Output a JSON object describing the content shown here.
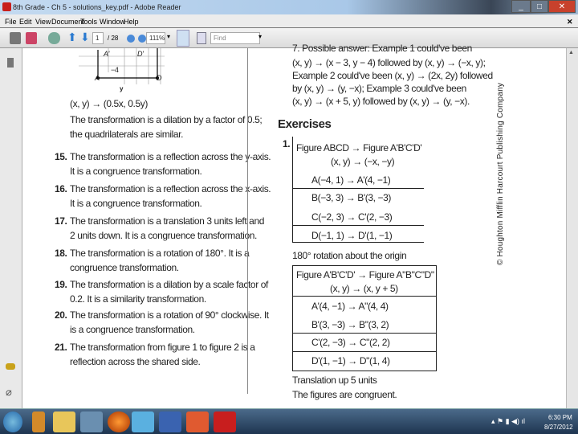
{
  "window": {
    "title": "8th Grade - Ch 5 - solutions_key.pdf - Adobe Reader",
    "controls": [
      "minimize",
      "maximize",
      "close"
    ]
  },
  "menu": [
    "File",
    "Edit",
    "View",
    "Document",
    "Tools",
    "Window",
    "Help"
  ],
  "toolbar": {
    "page_current": "1",
    "page_total": "/ 28",
    "zoom": "111%",
    "find_placeholder": "Find"
  },
  "document": {
    "figure_labels": {
      "a_prime": "A'",
      "d_prime": "D'",
      "a": "A",
      "d": "D",
      "minus4": "−4",
      "y": "y"
    },
    "left": {
      "rule": "(x, y) → (0.5x, 0.5y)",
      "intro": [
        "The transformation is a dilation by a factor of 0.5;",
        "the quadrilaterals are similar."
      ],
      "items": [
        {
          "num": "15.",
          "lines": [
            "The transformation is a reflection across the y-axis.",
            "It is a congruence transformation."
          ]
        },
        {
          "num": "16.",
          "lines": [
            "The transformation is a reflection across the x-axis.",
            "It is a congruence transformation."
          ]
        },
        {
          "num": "17.",
          "lines": [
            "The transformation is a translation 3 units left and",
            "2 units down. It is a congruence transformation."
          ]
        },
        {
          "num": "18.",
          "lines": [
            "The transformation is a rotation of 180°. It is a",
            "congruence transformation."
          ]
        },
        {
          "num": "19.",
          "lines": [
            "The transformation is a dilation by a scale factor of",
            "0.2. It is a similarity transformation."
          ]
        },
        {
          "num": "20.",
          "lines": [
            "The transformation is a rotation of 90° clockwise. It",
            "is a congruence transformation."
          ]
        },
        {
          "num": "21.",
          "lines": [
            "The transformation from figure 1 to figure 2 is a",
            "reflection across the shared side."
          ]
        }
      ]
    },
    "right": {
      "cut_line": "7. Possible answer: Example 1 could've been",
      "lines": [
        "(x, y) → (x − 3, y − 4) followed by (x, y) → (−x, y);",
        "Example 2 could've been (x, y) → (2x, 2y) followed",
        "by (x, y) → (y, −x); Example 3 could've been",
        "(x, y) → (x + 5, y) followed by (x, y) → (y, −x)."
      ],
      "exercises_heading": "Exercises",
      "ex1_num": "1.",
      "table1": {
        "header": "Figure ABCD → Figure A'B'C'D'",
        "rule": "(x, y) → (−x, −y)",
        "rows": [
          "A(−4, 1) → A'(4, −1)",
          "B(−3, 3) → B'(3, −3)",
          "C(−2, 3) → C'(2, −3)",
          "D(−1, 1) → D'(1, −1)"
        ]
      },
      "caption1": "180° rotation about the origin",
      "table2": {
        "header": "Figure A'B'C'D' → Figure A\"B\"C\"D\"",
        "rule": "(x, y) → (x, y + 5)",
        "rows": [
          "A'(4, −1) → A\"(4, 4)",
          "B'(3, −3) → B\"(3, 2)",
          "C'(2, −3) → C\"(2, 2)",
          "D'(1, −1) → D\"(1, 4)"
        ]
      },
      "caption2": [
        "Translation up 5 units",
        "The figures are congruent."
      ]
    },
    "copyright": "© Houghton Mifflin Harcourt Publishing Company"
  },
  "taskbar": {
    "time": "6:30 PM",
    "date": "8/27/2012",
    "apps": [
      "start",
      "media-player",
      "explorer",
      "paint",
      "firefox",
      "internet-explorer",
      "word",
      "powerpoint",
      "adobe-reader"
    ]
  }
}
